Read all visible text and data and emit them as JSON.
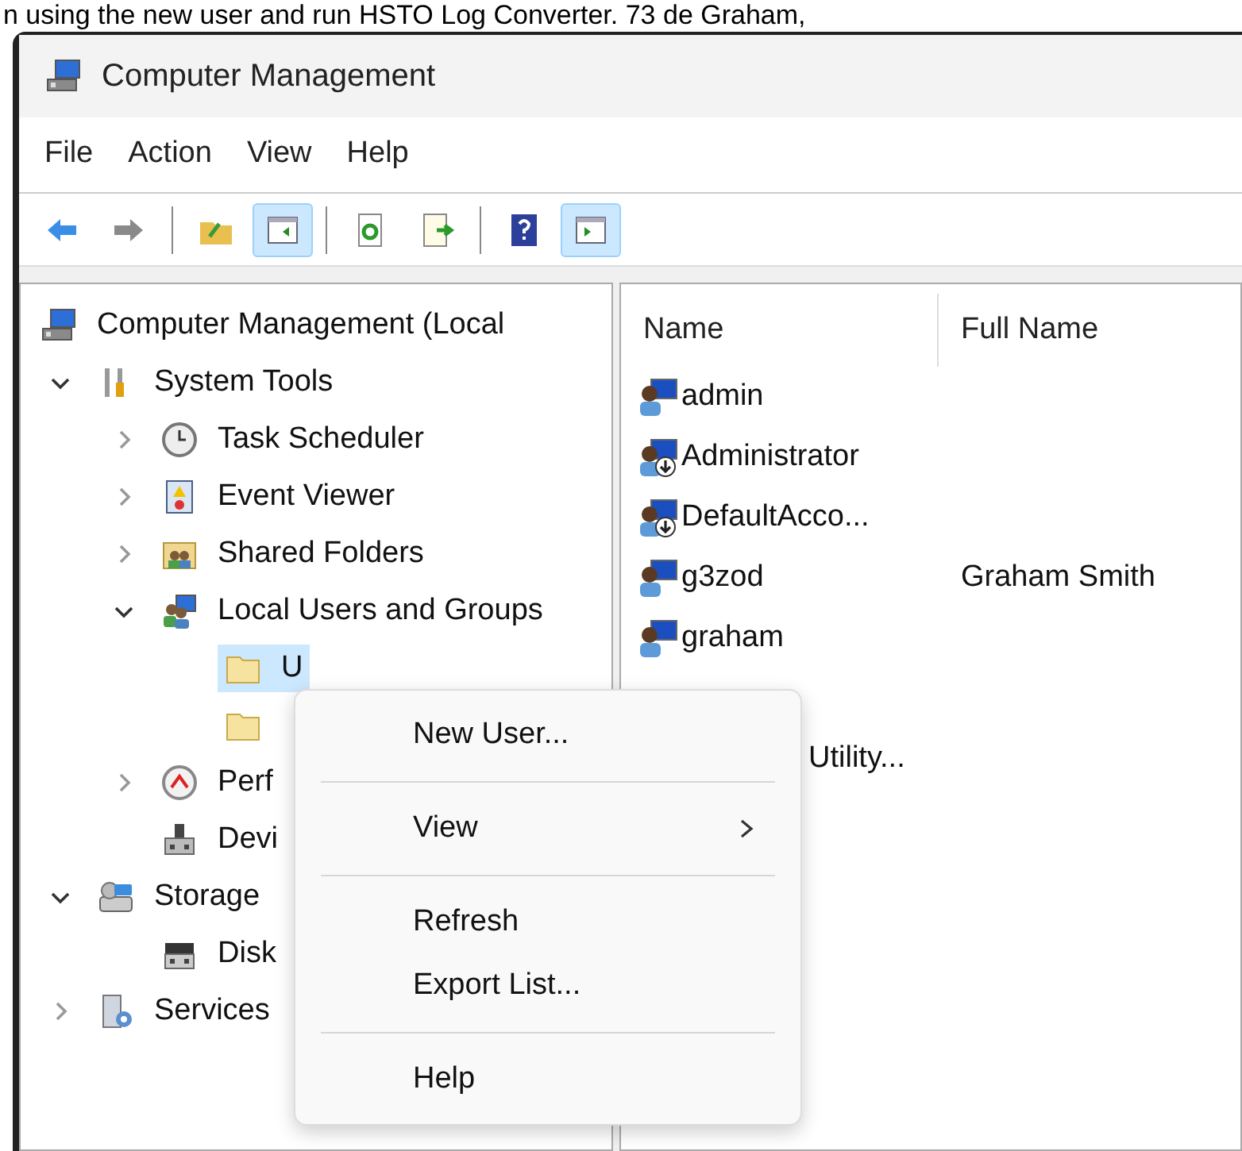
{
  "caption": "n using the new user and run HSTO Log Converter. 73 de Graham,",
  "window": {
    "title": "Computer Management"
  },
  "menu_bar": [
    "File",
    "Action",
    "View",
    "Help"
  ],
  "toolbar": [
    {
      "on": false
    },
    {
      "on": false
    },
    {
      "on": false
    },
    {
      "on": true
    },
    {
      "on": false
    },
    {
      "on": false
    },
    {
      "on": false
    },
    {
      "on": true
    }
  ],
  "tree": [
    {
      "label": "Computer Management (Local",
      "selected": false,
      "children": [
        {
          "label": "System Tools",
          "selected": false,
          "expanded": true,
          "children": [
            {
              "label": "Task Scheduler",
              "selected": false,
              "expanded": false
            },
            {
              "label": "Event Viewer",
              "selected": false,
              "expanded": false
            },
            {
              "label": "Shared Folders",
              "selected": false,
              "expanded": false
            },
            {
              "label": "Local Users and Groups",
              "selected": false,
              "expanded": true,
              "children": [
                {
                  "label": "U",
                  "selected": true
                },
                {
                  "selected": false
                }
              ]
            },
            {
              "label": "Perf",
              "selected": false,
              "expanded": false
            },
            {
              "label": "Devi",
              "selected": false
            }
          ]
        },
        {
          "label": "Storage",
          "selected": false,
          "expanded": true,
          "children": [
            {
              "label": "Disk",
              "selected": false
            }
          ]
        },
        {
          "label": "Services",
          "selected": false,
          "expanded": false
        }
      ]
    }
  ],
  "list": {
    "columns": [
      "Name",
      "Full Name"
    ],
    "rows": [
      {
        "name": "admin",
        "full_name": "",
        "disabled": false
      },
      {
        "name": "Administrator",
        "disabled": true
      },
      {
        "name": "DefaultAcco...",
        "disabled": true
      },
      {
        "name": "g3zod",
        "full_name": "Graham Smith",
        "disabled": false
      },
      {
        "name": "graham",
        "disabled": false
      }
    ],
    "partial_row": {
      "name": "Utility..."
    }
  },
  "context_menu": [
    {
      "kind": "item",
      "label": "New User..."
    },
    {
      "kind": "separator"
    },
    {
      "kind": "item",
      "label": "View",
      "submenu": true
    },
    {
      "kind": "separator"
    },
    {
      "kind": "item",
      "label": "Refresh"
    },
    {
      "kind": "item",
      "label": "Export List..."
    },
    {
      "kind": "separator"
    },
    {
      "kind": "item",
      "label": "Help"
    }
  ]
}
